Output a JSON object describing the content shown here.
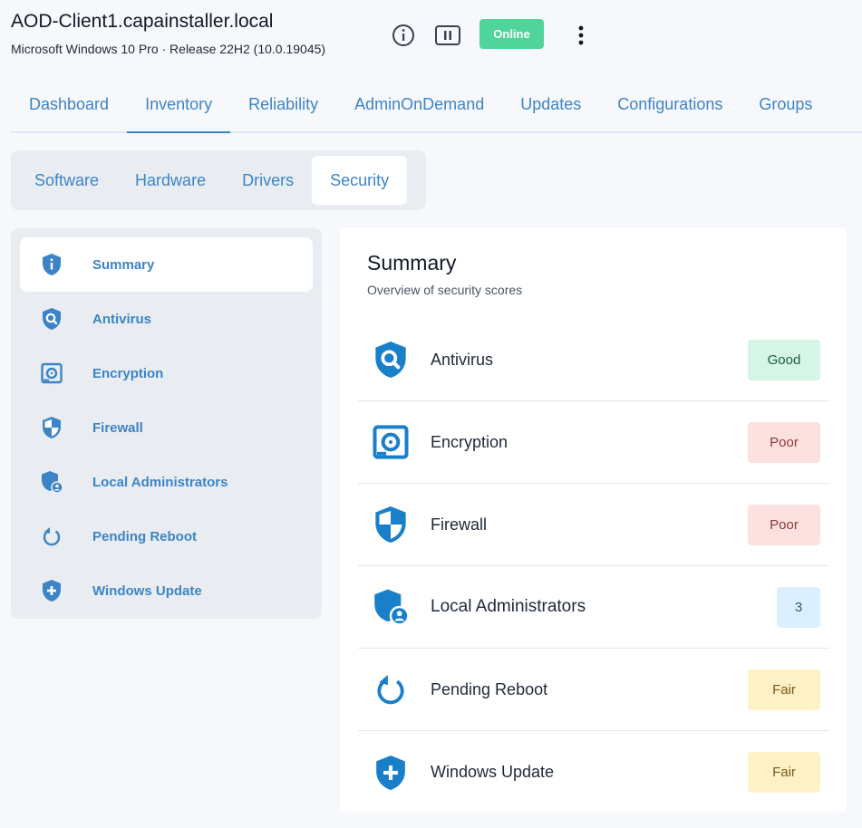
{
  "header": {
    "hostname": "AOD-Client1.capainstaller.local",
    "os_info": "Microsoft Windows 10 Pro · Release 22H2 (10.0.19045)",
    "status": "Online",
    "icons": [
      "info-icon",
      "pause-icon",
      "more-vertical-icon"
    ]
  },
  "main_tabs": [
    {
      "label": "Dashboard"
    },
    {
      "label": "Inventory"
    },
    {
      "label": "Reliability"
    },
    {
      "label": "AdminOnDemand"
    },
    {
      "label": "Updates"
    },
    {
      "label": "Configurations"
    },
    {
      "label": "Groups"
    }
  ],
  "sub_tabs": [
    {
      "label": "Software"
    },
    {
      "label": "Hardware"
    },
    {
      "label": "Drivers"
    },
    {
      "label": "Security"
    }
  ],
  "sidebar": {
    "items": [
      {
        "label": "Summary",
        "icon": "shield-info-icon"
      },
      {
        "label": "Antivirus",
        "icon": "shield-search-icon"
      },
      {
        "label": "Encryption",
        "icon": "disk-icon"
      },
      {
        "label": "Firewall",
        "icon": "shield-half-icon"
      },
      {
        "label": "Local Administrators",
        "icon": "shield-user-icon"
      },
      {
        "label": "Pending Reboot",
        "icon": "refresh-icon"
      },
      {
        "label": "Windows Update",
        "icon": "shield-plus-icon"
      }
    ]
  },
  "summary": {
    "title": "Summary",
    "subtitle": "Overview of security scores",
    "rows": [
      {
        "label": "Antivirus",
        "value": "Good",
        "status": "good"
      },
      {
        "label": "Encryption",
        "value": "Poor",
        "status": "poor"
      },
      {
        "label": "Firewall",
        "value": "Poor",
        "status": "poor"
      },
      {
        "label": "Local Administrators",
        "value": "3",
        "status": "count"
      },
      {
        "label": "Pending Reboot",
        "value": "Fair",
        "status": "fair"
      },
      {
        "label": "Windows Update",
        "value": "Fair",
        "status": "fair"
      }
    ]
  },
  "colors": {
    "accent": "#3d84c6",
    "icon_blue": "#1a7fc9",
    "online": "#4fd49a",
    "good_bg": "#d5f5e6",
    "poor_bg": "#fde0e0",
    "fair_bg": "#fdf1c8",
    "count_bg": "#dcefff"
  }
}
